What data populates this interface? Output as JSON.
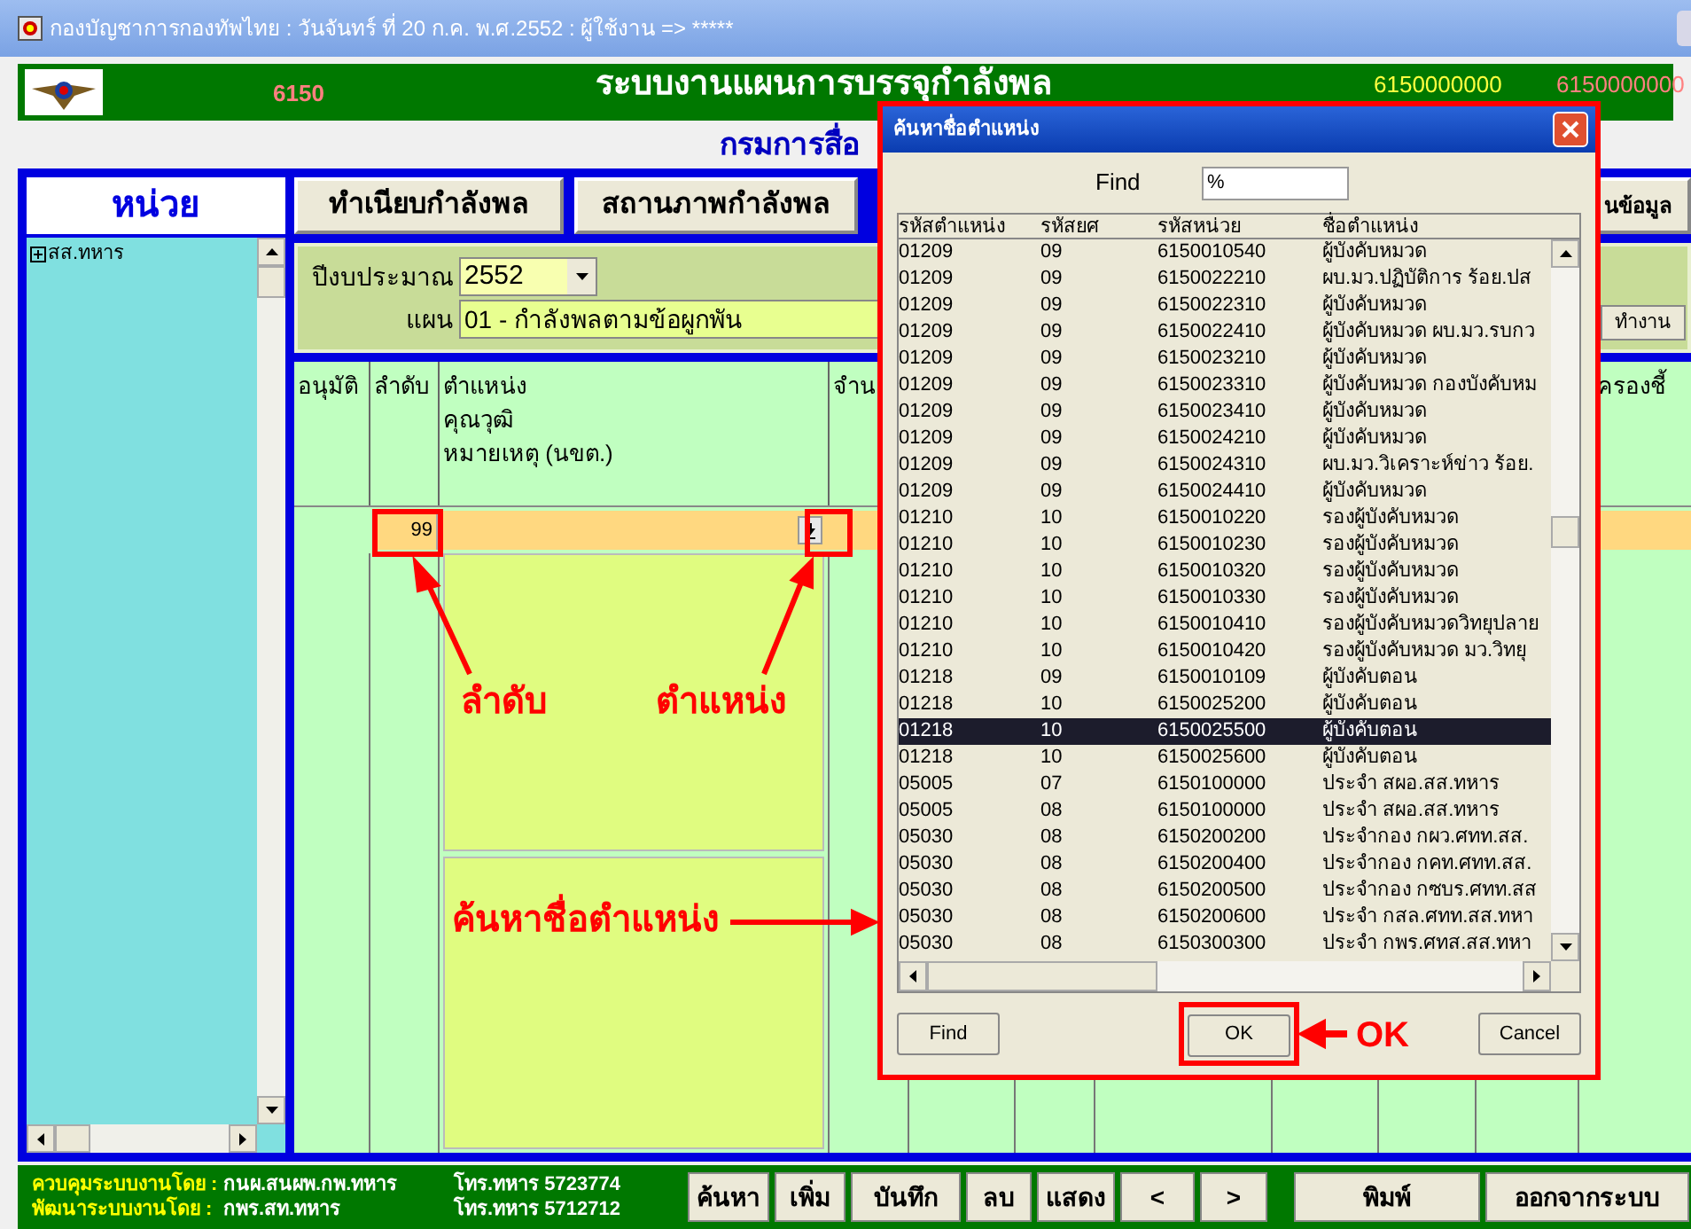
{
  "window": {
    "title": "กองบัญชาการกองทัพไทย : วันจันทร์ ที่ 20 ก.ค. พ.ศ.2552 : ผู้ใช้งาน => *****"
  },
  "header": {
    "code": "6150",
    "title": "ระบบงานแผนการบรรจุกำลังพล",
    "unit_code": "6150000000",
    "unit_code_2": "6150000000"
  },
  "department": "กรมการสื่อ",
  "panel_title": "หน่วย",
  "top_buttons": [
    "ทำเนียบกำลังพล",
    "สถานภาพกำลังพล",
    "นข้อมูล"
  ],
  "tree": [
    {
      "label": "สส.ทหาร",
      "expanded": false
    }
  ],
  "filter": {
    "year_label": "ปีงบประมาณ",
    "year": "2552",
    "plan_label": "แผน",
    "plan": "01 - กำลังพลตามข้อผูกพัน",
    "run_button": "ทำงาน"
  },
  "grid": {
    "columns": [
      "อนุมัติ",
      "ลำดับ",
      "ตำแหน่ง\nคุณวุฒิ\nหมายเหตุ (นขต.)",
      "จำน",
      "ครองชี้"
    ],
    "rows": [
      {
        "order": "99"
      }
    ]
  },
  "annotations": [
    {
      "text": "ลำดับ"
    },
    {
      "text": "ตำแหน่ง"
    },
    {
      "text": "ค้นหาชื่อตำแหน่ง"
    },
    {
      "text": "OK"
    }
  ],
  "dialog": {
    "title": "ค้นหาชื่อตำแหน่ง",
    "find_label": "Find",
    "find_value": "%",
    "columns": [
      "รหัสตำแหน่ง",
      "รหัสยศ",
      "รหัสหน่วย",
      "ชื่อตำแหน่ง"
    ],
    "rows": [
      {
        "cells": [
          "01209",
          "09",
          "6150010540",
          "ผู้บังคับหมวด"
        ],
        "selected": false
      },
      {
        "cells": [
          "01209",
          "09",
          "6150022210",
          "ผบ.มว.ปฏิบัติการ ร้อย.ปส"
        ],
        "selected": false
      },
      {
        "cells": [
          "01209",
          "09",
          "6150022310",
          "ผู้บังคับหมวด"
        ],
        "selected": false
      },
      {
        "cells": [
          "01209",
          "09",
          "6150022410",
          "ผู้บังคับหมวด ผบ.มว.รบกว"
        ],
        "selected": false
      },
      {
        "cells": [
          "01209",
          "09",
          "6150023210",
          "ผู้บังคับหมวด"
        ],
        "selected": false
      },
      {
        "cells": [
          "01209",
          "09",
          "6150023310",
          "ผู้บังคับหมวด กองบังคับหม"
        ],
        "selected": false
      },
      {
        "cells": [
          "01209",
          "09",
          "6150023410",
          "ผู้บังคับหมวด"
        ],
        "selected": false
      },
      {
        "cells": [
          "01209",
          "09",
          "6150024210",
          "ผู้บังคับหมวด"
        ],
        "selected": false
      },
      {
        "cells": [
          "01209",
          "09",
          "6150024310",
          "ผบ.มว.วิเคราะห์ข่าว ร้อย."
        ],
        "selected": false
      },
      {
        "cells": [
          "01209",
          "09",
          "6150024410",
          "ผู้บังคับหมวด"
        ],
        "selected": false
      },
      {
        "cells": [
          "01210",
          "10",
          "6150010220",
          "รองผู้บังคับหมวด"
        ],
        "selected": false
      },
      {
        "cells": [
          "01210",
          "10",
          "6150010230",
          "รองผู้บังคับหมวด"
        ],
        "selected": false
      },
      {
        "cells": [
          "01210",
          "10",
          "6150010320",
          "รองผู้บังคับหมวด"
        ],
        "selected": false
      },
      {
        "cells": [
          "01210",
          "10",
          "6150010330",
          "รองผู้บังคับหมวด"
        ],
        "selected": false
      },
      {
        "cells": [
          "01210",
          "10",
          "6150010410",
          "รองผู้บังคับหมวดวิทยุปลาย"
        ],
        "selected": false
      },
      {
        "cells": [
          "01210",
          "10",
          "6150010420",
          "รองผู้บังคับหมวด มว.วิทยุ"
        ],
        "selected": false
      },
      {
        "cells": [
          "01218",
          "09",
          "6150010109",
          "ผู้บังคับตอน"
        ],
        "selected": false
      },
      {
        "cells": [
          "01218",
          "10",
          "6150025200",
          "ผู้บังคับตอน"
        ],
        "selected": false
      },
      {
        "cells": [
          "01218",
          "10",
          "6150025500",
          "ผู้บังคับตอน"
        ],
        "selected": true
      },
      {
        "cells": [
          "01218",
          "10",
          "6150025600",
          "ผู้บังคับตอน"
        ],
        "selected": false
      },
      {
        "cells": [
          "05005",
          "07",
          "6150100000",
          "ประจำ สผอ.สส.ทหาร"
        ],
        "selected": false
      },
      {
        "cells": [
          "05005",
          "08",
          "6150100000",
          "ประจำ สผอ.สส.ทหาร"
        ],
        "selected": false
      },
      {
        "cells": [
          "05030",
          "08",
          "6150200200",
          "ประจำกอง กผว.ศทท.สส."
        ],
        "selected": false
      },
      {
        "cells": [
          "05030",
          "08",
          "6150200400",
          "ประจำกอง กคท.ศทท.สส."
        ],
        "selected": false
      },
      {
        "cells": [
          "05030",
          "08",
          "6150200500",
          "ประจำกอง กซบร.ศทท.สส"
        ],
        "selected": false
      },
      {
        "cells": [
          "05030",
          "08",
          "6150200600",
          "ประจำ กสล.ศทท.สส.ทหา"
        ],
        "selected": false
      },
      {
        "cells": [
          "05030",
          "08",
          "6150300300",
          "ประจำ กพร.ศทส.สส.ทหา"
        ],
        "selected": false
      }
    ],
    "buttons": [
      "Find",
      "OK",
      "Cancel"
    ]
  },
  "footer": {
    "credits": [
      {
        "label": "ควบคุมระบบงานโดย :",
        "org": "กนผ.สนผพ.กพ.ทหาร",
        "phone": "โทร.ทหาร 5723774"
      },
      {
        "label": "พัฒนาระบบงานโดย :",
        "org": "กพร.สท.ทหาร",
        "phone": "โทร.ทหาร 5712712"
      }
    ],
    "buttons": [
      "ค้นหา",
      "เพิ่ม",
      "บันทึก",
      "ลบ",
      "แสดง",
      "<",
      ">",
      "พิมพ์",
      "ออกจากระบบ"
    ]
  }
}
